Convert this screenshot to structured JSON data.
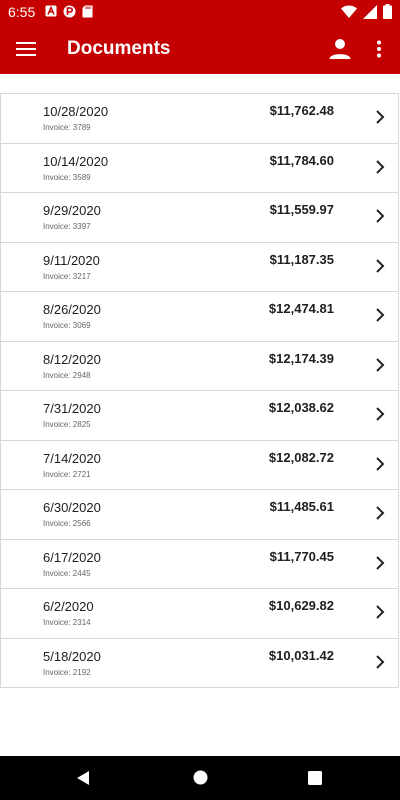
{
  "status_bar": {
    "time": "6:55",
    "icons": [
      "text-a-icon",
      "p-badge-icon",
      "sd-card-icon",
      "wifi-icon",
      "signal-icon",
      "battery-icon"
    ]
  },
  "app_bar": {
    "title": "Documents",
    "menu_icon": "hamburger-menu-icon",
    "account_icon": "person-icon",
    "overflow_icon": "more-vertical-icon",
    "color": "#c40000"
  },
  "documents": [
    {
      "date": "10/28/2020",
      "invoice": "Invoice: 3789",
      "amount": "$11,762.48"
    },
    {
      "date": "10/14/2020",
      "invoice": "Invoice: 3589",
      "amount": "$11,784.60"
    },
    {
      "date": "9/29/2020",
      "invoice": "Invoice: 3397",
      "amount": "$11,559.97"
    },
    {
      "date": "9/11/2020",
      "invoice": "Invoice: 3217",
      "amount": "$11,187.35"
    },
    {
      "date": "8/26/2020",
      "invoice": "Invoice: 3069",
      "amount": "$12,474.81"
    },
    {
      "date": "8/12/2020",
      "invoice": "Invoice: 2948",
      "amount": "$12,174.39"
    },
    {
      "date": "7/31/2020",
      "invoice": "Invoice: 2825",
      "amount": "$12,038.62"
    },
    {
      "date": "7/14/2020",
      "invoice": "Invoice: 2721",
      "amount": "$12,082.72"
    },
    {
      "date": "6/30/2020",
      "invoice": "Invoice: 2566",
      "amount": "$11,485.61"
    },
    {
      "date": "6/17/2020",
      "invoice": "Invoice: 2445",
      "amount": "$11,770.45"
    },
    {
      "date": "6/2/2020",
      "invoice": "Invoice: 2314",
      "amount": "$10,629.82"
    },
    {
      "date": "5/18/2020",
      "invoice": "Invoice: 2192",
      "amount": "$10,031.42"
    }
  ],
  "nav_bar": {
    "icons": [
      "back-icon",
      "home-icon",
      "recents-icon"
    ]
  }
}
